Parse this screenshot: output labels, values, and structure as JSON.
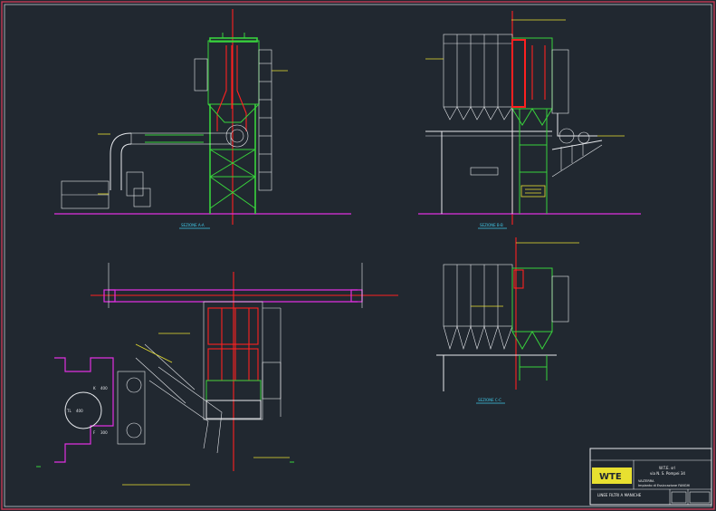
{
  "drawing": {
    "section_labels": {
      "a": "SEZIONE A-A",
      "b": "SEZIONE B-B",
      "c": "SEZIONE C-C"
    },
    "plan_labels": {
      "k": "K",
      "k_value": "400",
      "tl": "TL",
      "tl_value": "400",
      "f": "F",
      "f_value": "300"
    }
  },
  "title_block": {
    "logo": "WTE",
    "company": "W.T.E. srl",
    "address": "via N. S. Pompei 34",
    "project": "VALTERRA",
    "description": "Impianto di Essiccazione FANGHI",
    "sheet_title": "LINEE FILTRI A MANICHE",
    "colors": {
      "frame": "#c8c8c8",
      "logo_bg": "#e8e030"
    }
  },
  "colors": {
    "background": "#212830",
    "border": "#c23a55",
    "line_white": "#e6e8ec",
    "line_green": "#38d23c",
    "line_red": "#ff2020",
    "line_magenta": "#e030e0",
    "line_yellow": "#e8e030",
    "line_cyan": "#40c8e8"
  }
}
